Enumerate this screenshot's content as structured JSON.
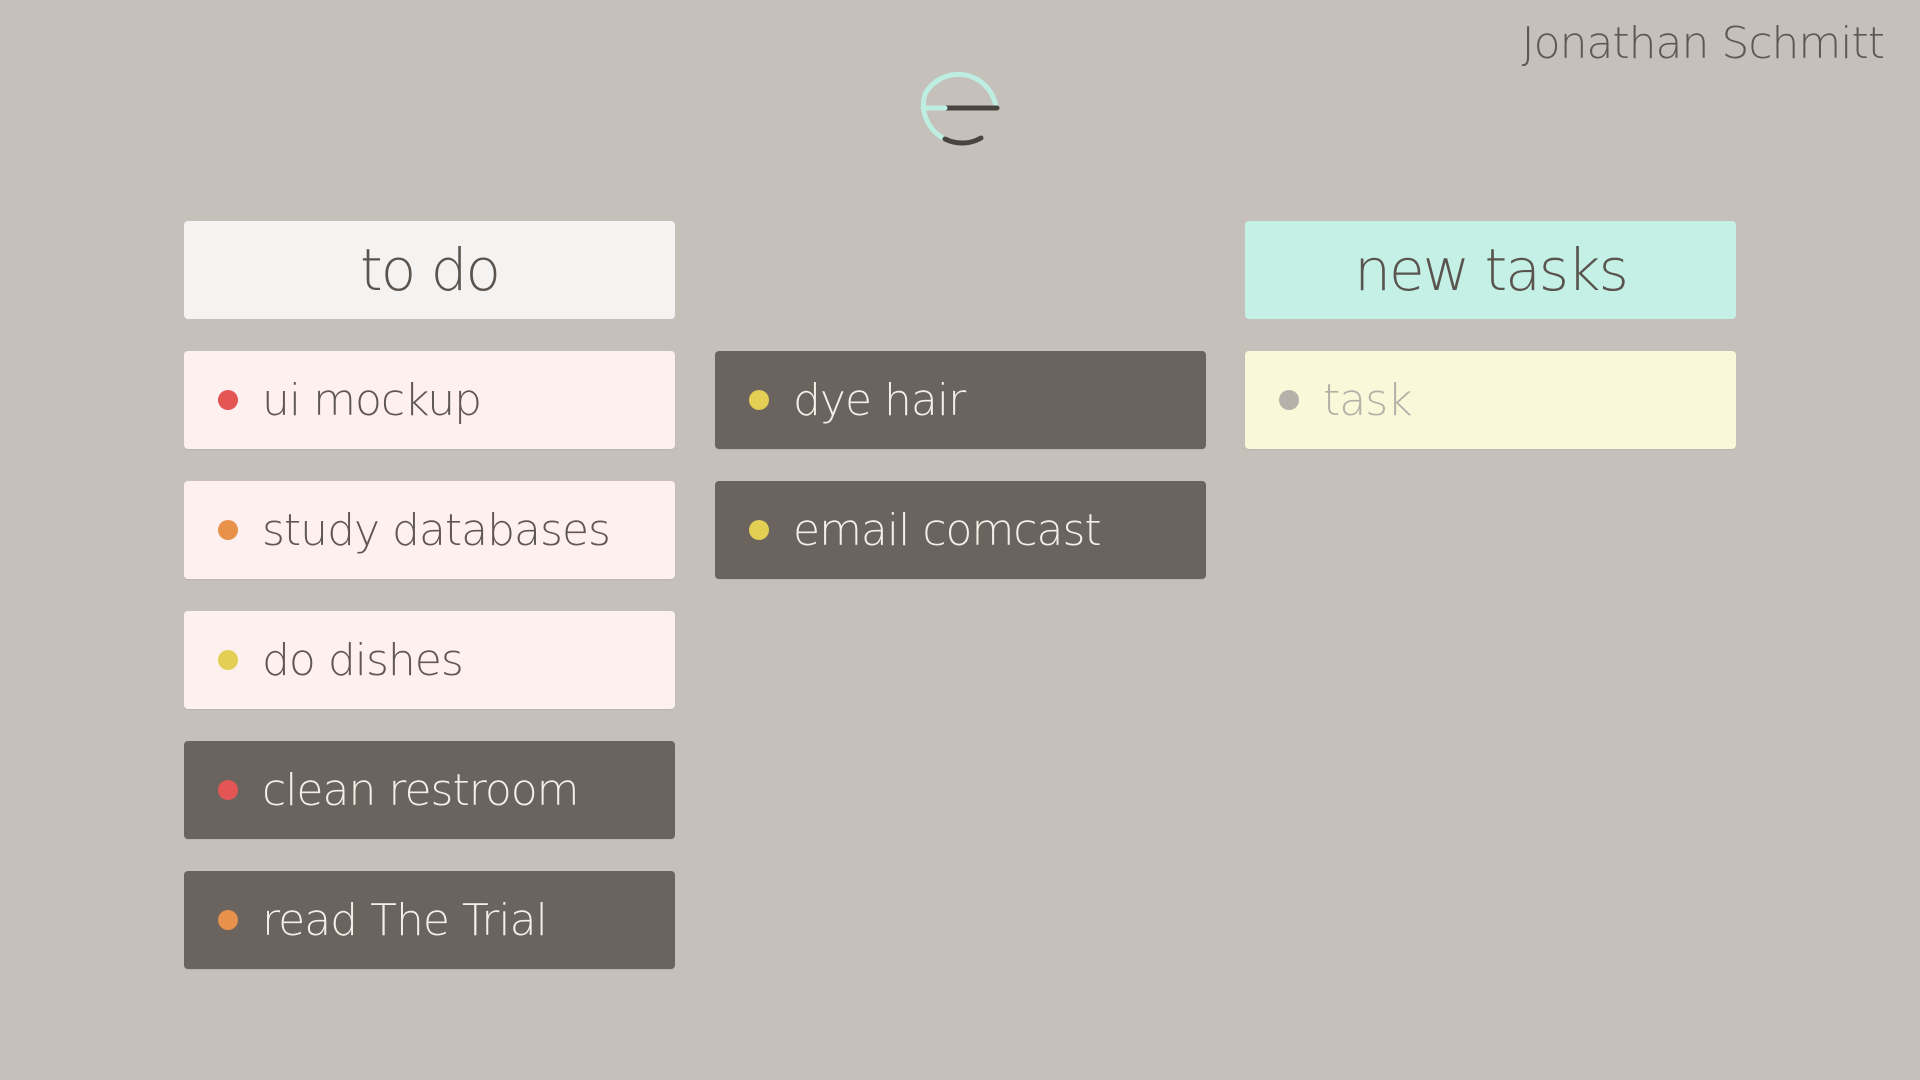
{
  "header": {
    "user_name": "Jonathan Schmitt",
    "logo_icon": "e-logo-icon",
    "logo_colors": {
      "arc": "#bdeee1",
      "stroke": "#4a4440"
    }
  },
  "columns": {
    "todo": {
      "title": "to do",
      "items": [
        {
          "label": "ui mockup",
          "dot_color": "#e45555"
        },
        {
          "label": "study databases",
          "dot_color": "#e8914a"
        },
        {
          "label": "do dishes",
          "dot_color": "#e3cf54"
        },
        {
          "label": "clean restroom",
          "dot_color": "#e45555"
        },
        {
          "label": "read The Trial",
          "dot_color": "#e8914a"
        }
      ]
    },
    "middle": {
      "items": [
        {
          "label": "dye hair",
          "dot_color": "#e3cf54"
        },
        {
          "label": "email comcast",
          "dot_color": "#e3cf54"
        }
      ]
    },
    "new_tasks": {
      "title": "new tasks",
      "input": {
        "placeholder": "task",
        "dot_color": "#b5b0aa"
      }
    }
  },
  "colors": {
    "background": "#c5c0ba",
    "card_light": "#fdf0ee",
    "card_dark": "#6b645e",
    "header_light": "#f4f3f1",
    "header_mint": "#c4f0e5",
    "input_card": "#fbf7d9"
  }
}
